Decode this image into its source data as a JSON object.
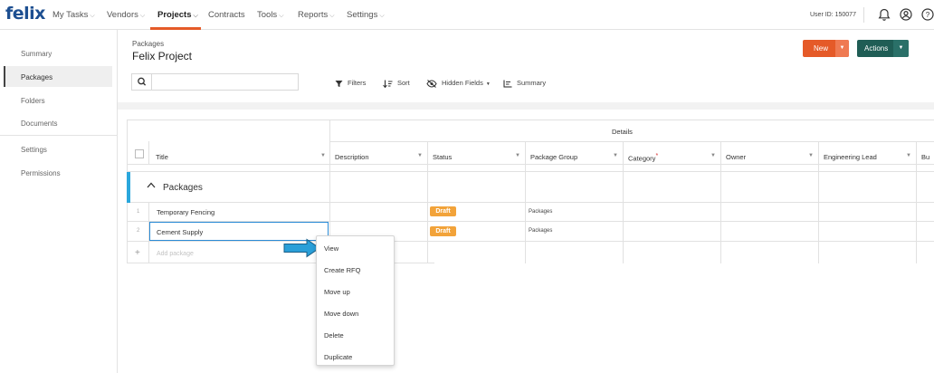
{
  "nav": {
    "logo": "felix",
    "items": [
      {
        "label": "My Tasks"
      },
      {
        "label": "Vendors"
      },
      {
        "label": "Projects"
      },
      {
        "label": "Contracts"
      },
      {
        "label": "Tools"
      },
      {
        "label": "Reports"
      },
      {
        "label": "Settings"
      }
    ],
    "active": "Projects",
    "user_id": "User ID: 150077"
  },
  "sidebar": {
    "items": [
      {
        "label": "Summary"
      },
      {
        "label": "Packages"
      },
      {
        "label": "Folders"
      },
      {
        "label": "Documents"
      },
      {
        "label": "Settings"
      },
      {
        "label": "Permissions"
      }
    ],
    "active": "Packages"
  },
  "header": {
    "breadcrumb": "Packages",
    "title": "Felix Project",
    "new_label": "New",
    "actions_label": "Actions"
  },
  "toolbar": {
    "search_placeholder": "",
    "filters": "Filters",
    "sort": "Sort",
    "hidden_fields": "Hidden Fields",
    "summary": "Summary"
  },
  "grid": {
    "group_header": "Details",
    "columns": [
      {
        "label": "Title"
      },
      {
        "label": "Description"
      },
      {
        "label": "Status"
      },
      {
        "label": "Package Group"
      },
      {
        "label": "Category",
        "required": true
      },
      {
        "label": "Owner"
      },
      {
        "label": "Engineering Lead"
      },
      {
        "label": "Bu"
      }
    ],
    "group_label": "Packages",
    "rows": [
      {
        "num": "1",
        "title": "Temporary Fencing",
        "status": "Draft",
        "package_group": "Packages"
      },
      {
        "num": "2",
        "title": "Cement Supply",
        "status": "Draft",
        "package_group": "Packages"
      }
    ],
    "add_placeholder": "Add package"
  },
  "context_menu": {
    "items": [
      {
        "label": "View"
      },
      {
        "label": "Create RFQ"
      },
      {
        "label": "Move up"
      },
      {
        "label": "Move down"
      },
      {
        "label": "Delete"
      },
      {
        "label": "Duplicate"
      }
    ]
  },
  "colors": {
    "brand": "#1d4f91",
    "accent": "#e55a28",
    "actions": "#1f5d55",
    "draft_badge": "#f2a33a",
    "group_bar": "#2aa7dc",
    "pointer_arrow": "#2a9fd8"
  }
}
